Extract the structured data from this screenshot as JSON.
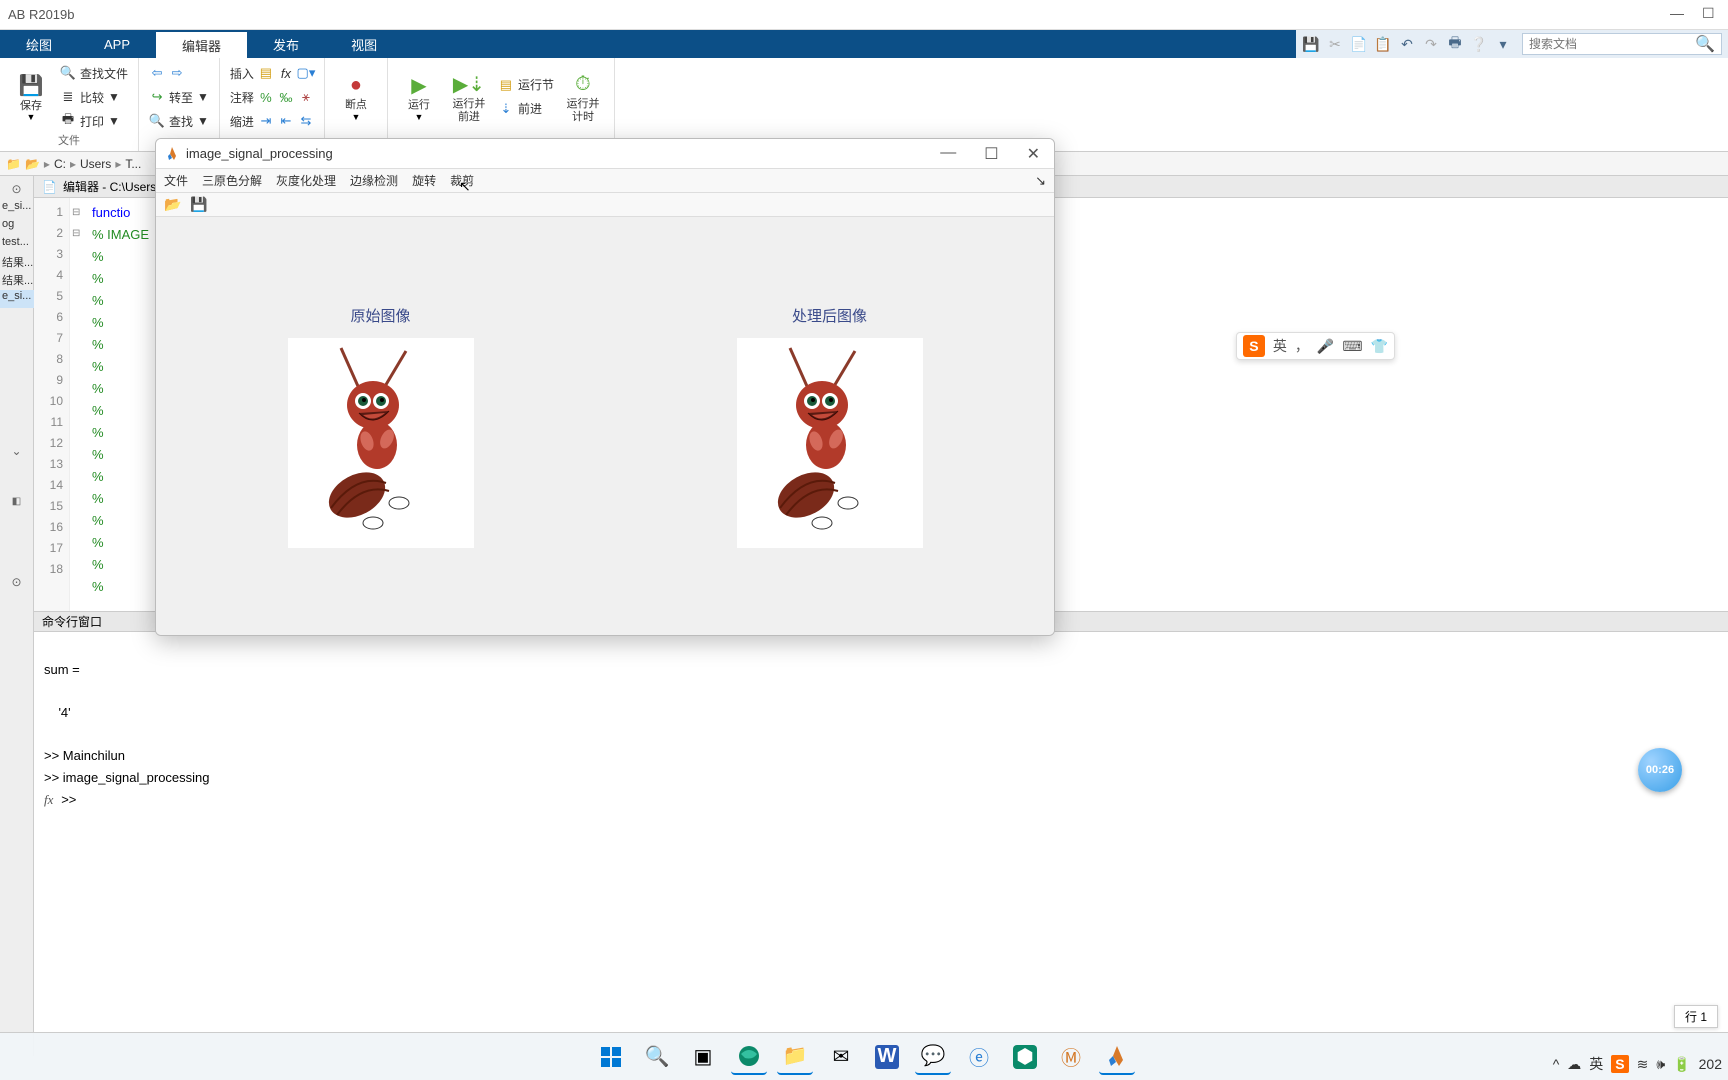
{
  "app": {
    "title": "AB R2019b",
    "window_min": "—",
    "window_max": "☐",
    "window_close": "✕"
  },
  "tabs": {
    "plot": "绘图",
    "app": "APP",
    "editor": "编辑器",
    "publish": "发布",
    "view": "视图"
  },
  "search": {
    "placeholder": "搜索文档"
  },
  "toolstrip": {
    "save": "保存",
    "find_files": "查找文件",
    "compare": "比较",
    "print": "打印",
    "goto": "转至",
    "find": "查找",
    "insert": "插入",
    "comment": "注释",
    "indent": "缩进",
    "breakpoints": "断点",
    "run": "运行",
    "run_advance": "运行并\n前进",
    "run_section": "运行节",
    "advance": "前进",
    "run_time": "运行并\n计时",
    "file_group": "文件"
  },
  "breadcrumb": {
    "c": "C:",
    "users": "Users",
    "rest": "T..."
  },
  "editor": {
    "header": "编辑器 - C:\\Users...",
    "line1": "functio",
    "line2": "% IMAGE",
    "pct": "%",
    "lines": [
      "1",
      "2",
      "3",
      "4",
      "5",
      "6",
      "7",
      "8",
      "9",
      "10",
      "11",
      "12",
      "13",
      "14",
      "15",
      "16",
      "17",
      "18"
    ]
  },
  "filelist": {
    "a": "e_si...",
    "b": "og",
    "c": "test...",
    "d": "结果...",
    "e": "结果...",
    "f": "e_si..."
  },
  "cmd": {
    "header": "命令行窗口",
    "out1": "sum =",
    "out2": "    '4'",
    "out3": ">> Mainchilun",
    "out4": ">> image_signal_processing",
    "prompt": ">> ",
    "fx": "fx"
  },
  "figure": {
    "title": "image_signal_processing",
    "menu": {
      "file": "文件",
      "rgb": "三原色分解",
      "gray": "灰度化处理",
      "edge": "边缘检测",
      "rotate": "旋转",
      "crop": "裁剪"
    },
    "left_caption": "原始图像",
    "right_caption": "处理后图像",
    "overflow": "↘"
  },
  "ime": {
    "lang": "英",
    "dot": "，",
    "mic": "🎤",
    "kb": "⌨",
    "t": "👕"
  },
  "timer": "00:26",
  "status": {
    "line_col": "行 1",
    "year": "202"
  },
  "tray": {
    "up": "^",
    "cloud": "☁",
    "lang2": "英",
    "s": "S",
    "net": "≋",
    "vol": "🕪",
    "bat": "🔋"
  }
}
